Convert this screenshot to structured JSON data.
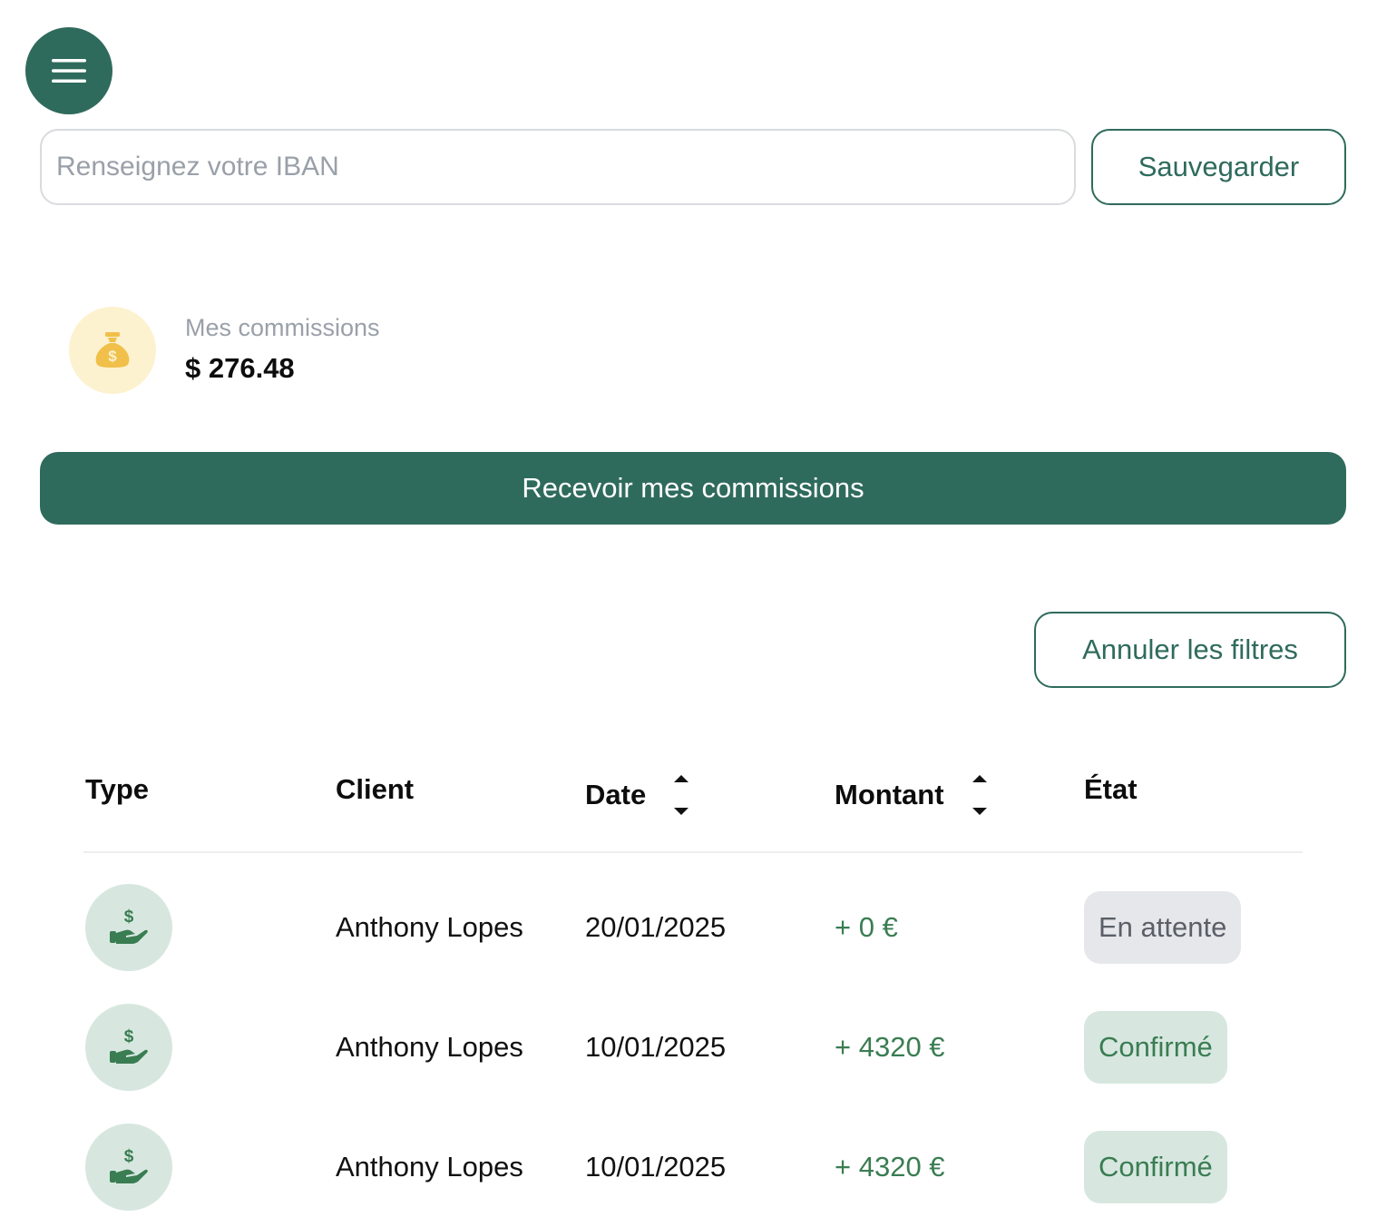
{
  "menu": {
    "icon": "hamburger-icon"
  },
  "iban": {
    "placeholder": "Renseignez votre IBAN",
    "value": "",
    "save_label": "Sauvegarder"
  },
  "commissions": {
    "icon": "money-bag-icon",
    "label": "Mes commissions",
    "amount": "$ 276.48"
  },
  "receive_label": "Recevoir mes commissions",
  "reset_filters_label": "Annuler les filtres",
  "table": {
    "headers": {
      "type": "Type",
      "client": "Client",
      "date": "Date",
      "amount": "Montant",
      "status": "État"
    },
    "rows": [
      {
        "type_icon": "hand-dollar-icon",
        "client": "Anthony Lopes",
        "date": "20/01/2025",
        "amount": "+ 0 €",
        "status": "En attente",
        "status_kind": "pending"
      },
      {
        "type_icon": "hand-dollar-icon",
        "client": "Anthony Lopes",
        "date": "10/01/2025",
        "amount": "+ 4320 €",
        "status": "Confirmé",
        "status_kind": "confirmed"
      },
      {
        "type_icon": "hand-dollar-icon",
        "client": "Anthony Lopes",
        "date": "10/01/2025",
        "amount": "+ 4320 €",
        "status": "Confirmé",
        "status_kind": "confirmed"
      }
    ]
  },
  "colors": {
    "brand": "#2f6b5c",
    "amount_green": "#3a7d52",
    "pending_bg": "#e6e7ea",
    "confirmed_bg": "#d7e7e0",
    "coin_bg": "#fdf2cf",
    "coin_gold": "#f0c04a"
  }
}
